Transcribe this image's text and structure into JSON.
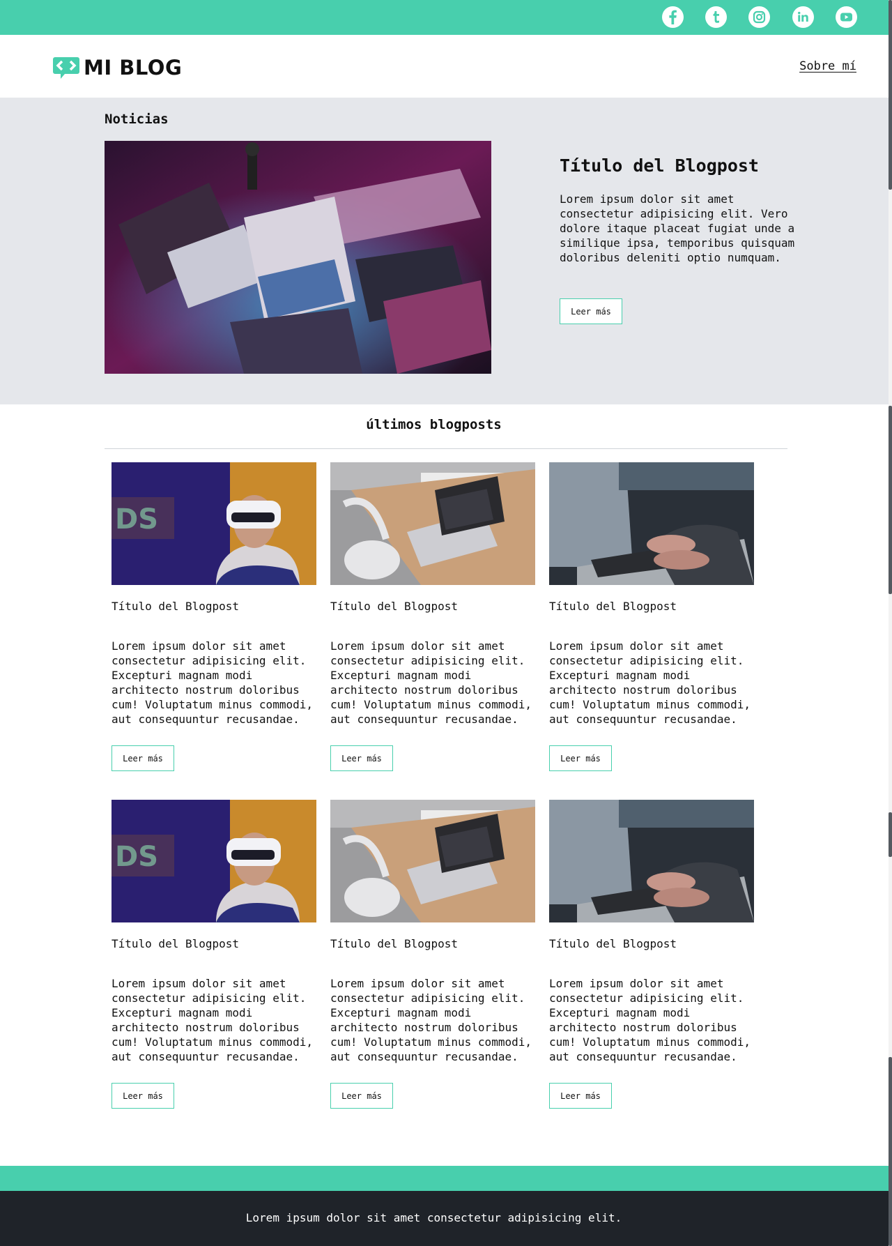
{
  "social": [
    {
      "icon": "facebook-icon"
    },
    {
      "icon": "tumblr-icon"
    },
    {
      "icon": "instagram-icon"
    },
    {
      "icon": "linkedin-icon"
    },
    {
      "icon": "youtube-icon"
    }
  ],
  "brand": {
    "name": "MI BLOG",
    "accent": "#48cfad"
  },
  "nav": {
    "about": "Sobre mí"
  },
  "hero": {
    "heading": "Noticias",
    "title": "Título del Blogpost",
    "body": "Lorem ipsum dolor sit amet consectetur adipisicing elit. Vero dolore itaque placeat fugiat unde a similique ipsa, temporibus quisquam doloribus deleniti optio numquam.",
    "button": "Leer más"
  },
  "latest": {
    "heading": "últimos blogposts",
    "posts": [
      {
        "title": "Título del Blogpost",
        "body": "Lorem ipsum dolor sit amet consectetur adipisicing elit. Excepturi magnam modi architecto nostrum doloribus cum! Voluptatum minus commodi, aut consequuntur recusandae.",
        "button": "Leer más"
      },
      {
        "title": "Título del Blogpost",
        "body": "Lorem ipsum dolor sit amet consectetur adipisicing elit. Excepturi magnam modi architecto nostrum doloribus cum! Voluptatum minus commodi, aut consequuntur recusandae.",
        "button": "Leer más"
      },
      {
        "title": "Título del Blogpost",
        "body": "Lorem ipsum dolor sit amet consectetur adipisicing elit. Excepturi magnam modi architecto nostrum doloribus cum! Voluptatum minus commodi, aut consequuntur recusandae.",
        "button": "Leer más"
      },
      {
        "title": "Título del Blogpost",
        "body": "Lorem ipsum dolor sit amet consectetur adipisicing elit. Excepturi magnam modi architecto nostrum doloribus cum! Voluptatum minus commodi, aut consequuntur recusandae.",
        "button": "Leer más"
      },
      {
        "title": "Título del Blogpost",
        "body": "Lorem ipsum dolor sit amet consectetur adipisicing elit. Excepturi magnam modi architecto nostrum doloribus cum! Voluptatum minus commodi, aut consequuntur recusandae.",
        "button": "Leer más"
      },
      {
        "title": "Título del Blogpost",
        "body": "Lorem ipsum dolor sit amet consectetur adipisicing elit. Excepturi magnam modi architecto nostrum doloribus cum! Voluptatum minus commodi, aut consequuntur recusandae.",
        "button": "Leer más"
      }
    ]
  },
  "footer": {
    "text": "Lorem ipsum dolor sit amet consectetur adipisicing elit."
  }
}
